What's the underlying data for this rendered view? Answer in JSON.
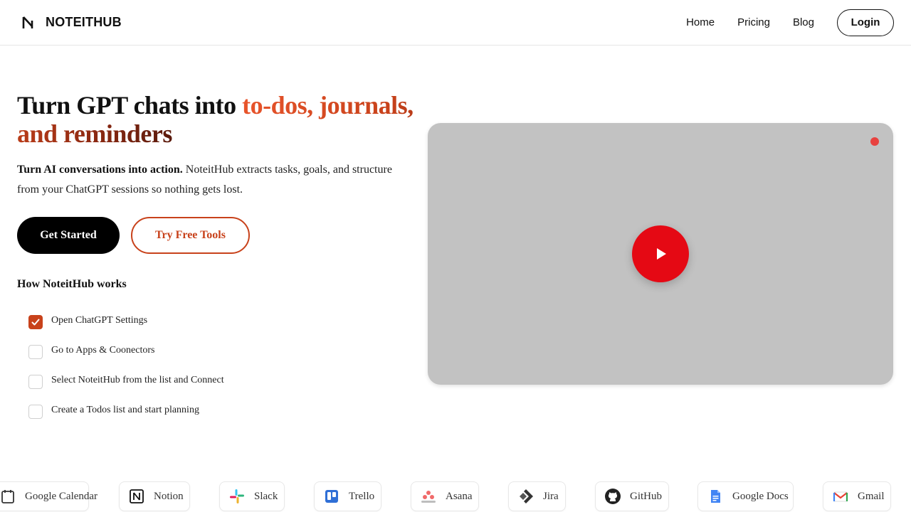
{
  "header": {
    "brand": "NOTEITHUB",
    "nav": [
      "Home",
      "Pricing",
      "Blog"
    ],
    "login": "Login"
  },
  "hero": {
    "title_plain": "Turn GPT chats into ",
    "title_accent": "to-dos, journals, and reminders",
    "sub_bold": "Turn AI conversations into action.",
    "sub_rest": " NoteitHub extracts tasks, goals, and structure from your ChatGPT sessions so nothing gets lost.",
    "primary_cta": "Get Started",
    "secondary_cta": "Try Free Tools"
  },
  "how": {
    "title": "How NoteitHub works",
    "steps": [
      {
        "label": "Open ChatGPT Settings",
        "checked": true
      },
      {
        "label": "Go to Apps & Coonectors",
        "checked": false
      },
      {
        "label": "Select NoteitHub from the list and Connect",
        "checked": false
      },
      {
        "label": "Create a Todos list and start planning",
        "checked": false
      }
    ]
  },
  "integrations": [
    {
      "name": "Google Calendar",
      "icon": "google-calendar-icon"
    },
    {
      "name": "Notion",
      "icon": "notion-icon"
    },
    {
      "name": "Slack",
      "icon": "slack-icon"
    },
    {
      "name": "Trello",
      "icon": "trello-icon"
    },
    {
      "name": "Asana",
      "icon": "asana-icon"
    },
    {
      "name": "Jira",
      "icon": "jira-icon"
    },
    {
      "name": "GitHub",
      "icon": "github-icon"
    },
    {
      "name": "Google Docs",
      "icon": "google-docs-icon"
    },
    {
      "name": "Gmail",
      "icon": "gmail-icon"
    }
  ],
  "colors": {
    "accent": "#c8421b",
    "play": "#e50914",
    "video_bg": "#c2c2c2"
  }
}
